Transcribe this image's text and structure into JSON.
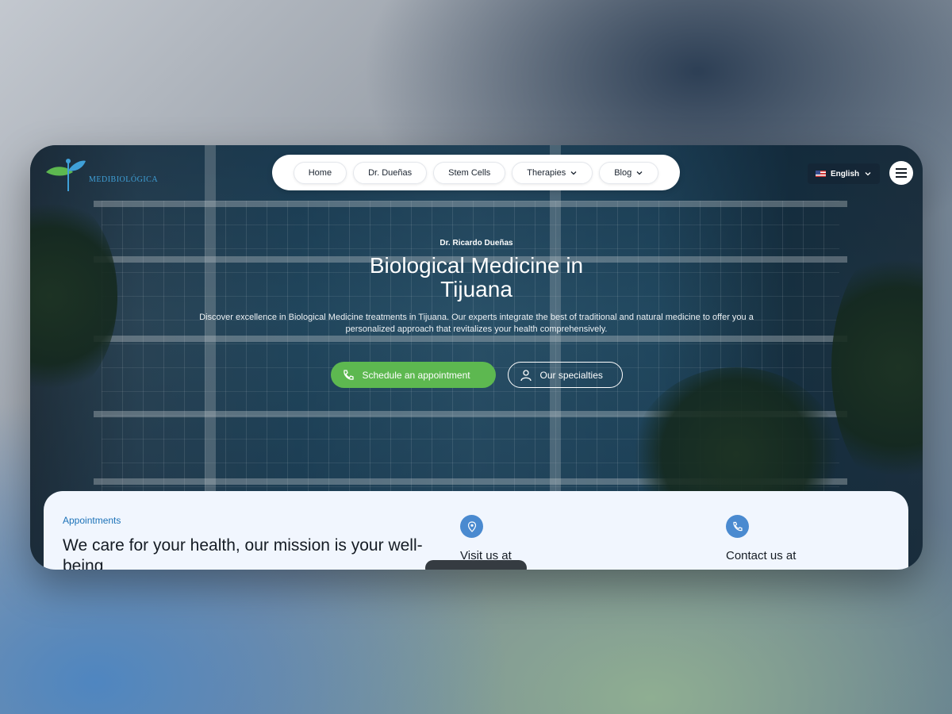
{
  "brand": {
    "logo_text": "MEDIBIOLÓGICA",
    "colors": {
      "green": "#5db850",
      "blue": "#1c72b8",
      "card": "#f1f6fe"
    }
  },
  "nav": {
    "items": [
      {
        "label": "Home",
        "has_dropdown": false
      },
      {
        "label": "Dr. Dueñas",
        "has_dropdown": false
      },
      {
        "label": "Stem Cells",
        "has_dropdown": false
      },
      {
        "label": "Therapies",
        "has_dropdown": true
      },
      {
        "label": "Blog",
        "has_dropdown": true
      }
    ]
  },
  "language": {
    "selected": "English",
    "flag": "us-flag-icon"
  },
  "menu": {
    "icon": "hamburger-icon"
  },
  "hero": {
    "eyebrow": "Dr. Ricardo Dueñas",
    "title": "Biological Medicine in Tijuana",
    "description": "Discover excellence in Biological Medicine treatments in Tijuana. Our experts integrate the best of traditional and natural medicine to offer you a personalized approach that revitalizes your health comprehensively.",
    "cta_primary": "Schedule an appointment",
    "cta_secondary": "Our specialties"
  },
  "info_card": {
    "label": "Appointments",
    "title": "We care for your health, our mission is your well-being",
    "visit_title": "Visit us at",
    "contact_title": "Contact us at"
  }
}
